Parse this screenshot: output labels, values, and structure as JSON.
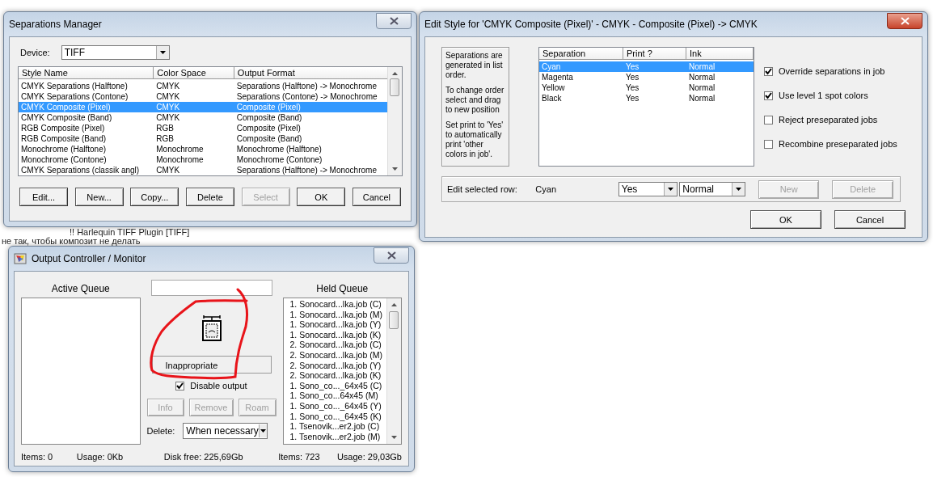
{
  "background_texts": [
    "!! Harlequin TIFF Plugin [TIFF]",
    "не так, чтобы композит не делать"
  ],
  "separations_manager": {
    "title": "Separations Manager",
    "device_label": "Device:",
    "device_value": "TIFF",
    "columns": [
      "Style Name",
      "Color Space",
      "Output Format"
    ],
    "rows": [
      {
        "cells": [
          "CMYK Separations (Halftone)",
          "CMYK",
          "Separations (Halftone) -> Monochrome"
        ],
        "selected": false
      },
      {
        "cells": [
          "CMYK Separations (Contone)",
          "CMYK",
          "Separations (Contone) -> Monochrome"
        ],
        "selected": false
      },
      {
        "cells": [
          "CMYK Composite (Pixel)",
          "CMYK",
          "Composite (Pixel)"
        ],
        "selected": true
      },
      {
        "cells": [
          "CMYK Composite (Band)",
          "CMYK",
          "Composite (Band)"
        ],
        "selected": false
      },
      {
        "cells": [
          "RGB Composite (Pixel)",
          "RGB",
          "Composite (Pixel)"
        ],
        "selected": false
      },
      {
        "cells": [
          "RGB Composite (Band)",
          "RGB",
          "Composite (Band)"
        ],
        "selected": false
      },
      {
        "cells": [
          "Monochrome (Halftone)",
          "Monochrome",
          "Monochrome (Halftone)"
        ],
        "selected": false
      },
      {
        "cells": [
          "Monochrome (Contone)",
          "Monochrome",
          "Monochrome (Contone)"
        ],
        "selected": false
      },
      {
        "cells": [
          "CMYK Separations (classik angl)",
          "CMYK",
          "Separations (Halftone) -> Monochrome"
        ],
        "selected": false
      }
    ],
    "buttons": [
      {
        "label": "Edit...",
        "disabled": false
      },
      {
        "label": "New...",
        "disabled": false
      },
      {
        "label": "Copy...",
        "disabled": false
      },
      {
        "label": "Delete",
        "disabled": false
      },
      {
        "label": "Select",
        "disabled": true
      },
      {
        "label": "OK",
        "disabled": false
      },
      {
        "label": "Cancel",
        "disabled": false
      }
    ]
  },
  "edit_style": {
    "title": "Edit Style for 'CMYK Composite (Pixel)' - CMYK - Composite (Pixel) -> CMYK",
    "help_texts": [
      "Separations are generated in list order.",
      "To change order select and drag to new position",
      "Set print to 'Yes' to automatically print 'other colors in job'."
    ],
    "columns": [
      "Separation",
      "Print ?",
      "Ink"
    ],
    "rows": [
      {
        "cells": [
          "Cyan",
          "Yes",
          "Normal"
        ],
        "selected": true
      },
      {
        "cells": [
          "Magenta",
          "Yes",
          "Normal"
        ],
        "selected": false
      },
      {
        "cells": [
          "Yellow",
          "Yes",
          "Normal"
        ],
        "selected": false
      },
      {
        "cells": [
          "Black",
          "Yes",
          "Normal"
        ],
        "selected": false
      }
    ],
    "options": [
      {
        "label": "Override separations in job",
        "checked": true
      },
      {
        "label": "Use level 1 spot colors",
        "checked": true
      },
      {
        "label": "Reject preseparated jobs",
        "checked": false
      },
      {
        "label": "Recombine preseparated jobs",
        "checked": false
      }
    ],
    "edit_row": {
      "label": "Edit selected row:",
      "name": "Cyan",
      "print_value": "Yes",
      "ink_value": "Normal"
    },
    "row_buttons": [
      {
        "label": "New",
        "disabled": true
      },
      {
        "label": "Delete",
        "disabled": true
      }
    ],
    "buttons": [
      {
        "label": "OK",
        "disabled": false
      },
      {
        "label": "Cancel",
        "disabled": false
      }
    ]
  },
  "output_controller": {
    "title": "Output Controller / Monitor",
    "active_queue_title": "Active Queue",
    "status_text": "Inappropriate",
    "disable_output": {
      "label": "Disable output",
      "checked": true
    },
    "buttons": [
      {
        "label": "Info",
        "disabled": true
      },
      {
        "label": "Remove",
        "disabled": true
      },
      {
        "label": "Roam",
        "disabled": true
      }
    ],
    "delete_label": "Delete:",
    "delete_value": "When necessary",
    "held_queue_title": "Held Queue",
    "held_items": [
      "1. Sonocard...lka.job (C)",
      "1. Sonocard...lka.job (M)",
      "1. Sonocard...lka.job (Y)",
      "1. Sonocard...lka.job (K)",
      "2. Sonocard...lka.job (C)",
      "2. Sonocard...lka.job (M)",
      "2. Sonocard...lka.job (Y)",
      "2. Sonocard...lka.job (K)",
      "1. Sono_co..._64x45 (C)",
      "1. Sono_co...64x45 (M)",
      "1. Sono_co..._64x45 (Y)",
      "1. Sono_co..._64x45 (K)",
      "1. Tsenovik...er2.job (C)",
      "1. Tsenovik...er2.job (M)"
    ],
    "status_bar": [
      "Items:  0",
      "Usage: 0Kb",
      "Disk free:  225,69Gb",
      "Items:  723",
      "Usage: 29,03Gb"
    ]
  }
}
